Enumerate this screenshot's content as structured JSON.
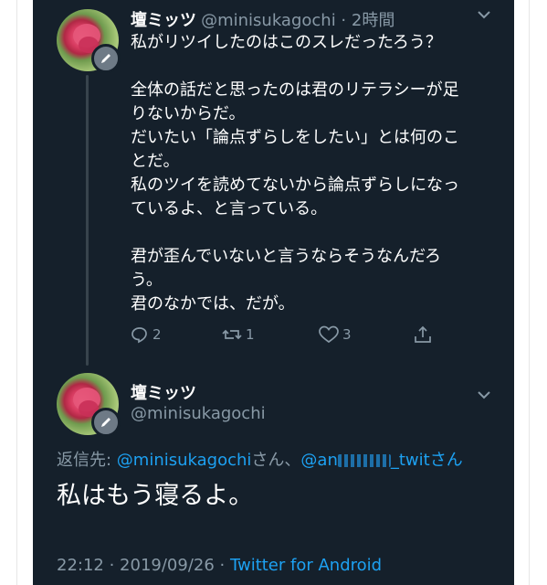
{
  "colors": {
    "background": "#15202b",
    "text": "#ffffff",
    "muted": "#8899a6",
    "link": "#1da1f2"
  },
  "tweet1": {
    "display_name": "壇ミッツ",
    "handle_time": "@minisukagochi · 2時間",
    "lines": [
      "私がリツイしたのはこのスレだったろう？",
      "",
      "全体の話だと思ったのは君のリテラシーが足",
      "りないからだ。",
      "だいたい「論点ずらしをしたい」とは何のこ",
      "とだ。",
      "私のツイを読めてないから論点ずらしになっ",
      "ているよ、と言っている。",
      "",
      "君が歪んでいないと言うならそうなんだろ",
      "う。",
      "君のなかでは、だが。"
    ],
    "reply_count": "2",
    "retweet_count": "1",
    "like_count": "3",
    "icons": [
      "reply-icon",
      "retweet-icon",
      "like-icon",
      "share-icon",
      "chevron-down-icon"
    ]
  },
  "tweet2": {
    "display_name": "壇ミッツ",
    "handle": "@minisukagochi",
    "reply_label": "返信先: ",
    "reply_to_1": "@minisukagochi",
    "reply_sep": "さん、",
    "reply_to_2_prefix": "@an",
    "reply_to_2_suffix": "_twit",
    "reply_suffix": "さん",
    "text": "私はもう寝るよ。",
    "timestamp": "22:12 · 2019/09/26 · ",
    "client": "Twitter for Android"
  }
}
